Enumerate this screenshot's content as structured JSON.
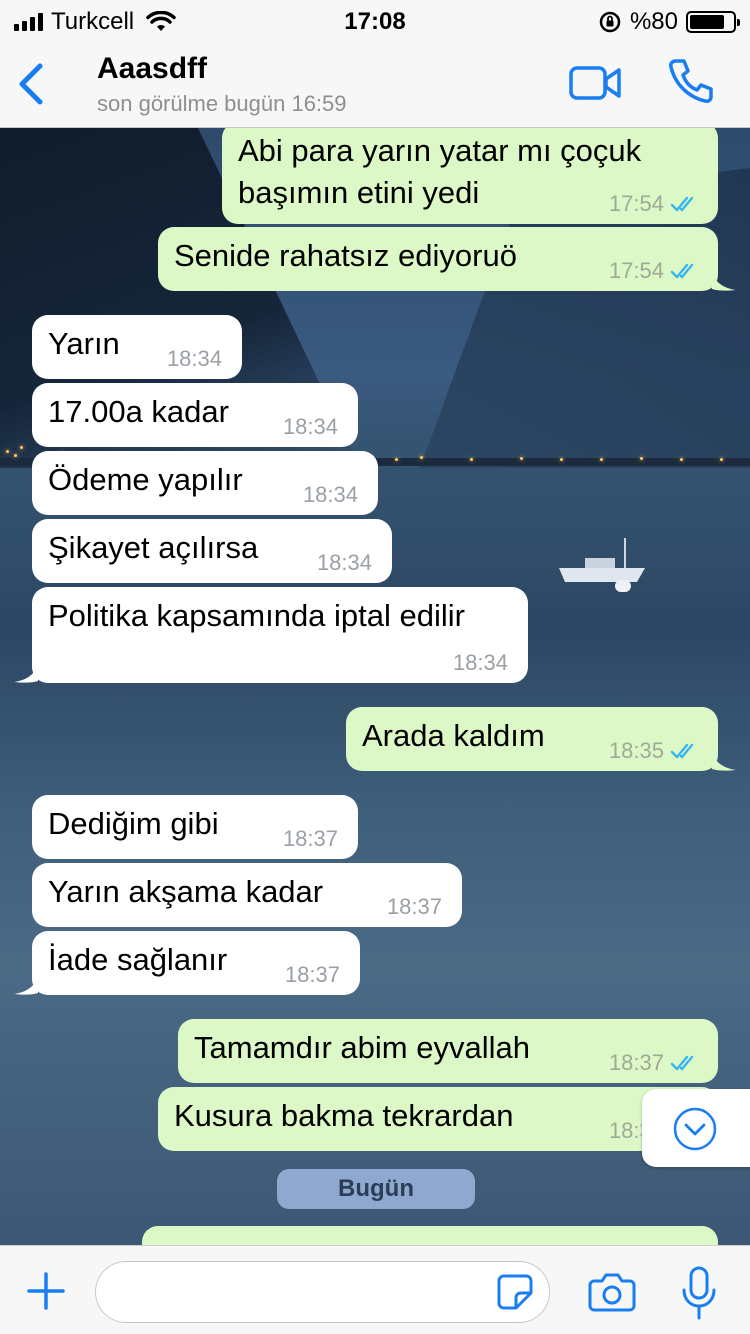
{
  "status_bar": {
    "carrier": "Turkcell",
    "time": "17:08",
    "battery_text": "%80",
    "battery_level": 0.8
  },
  "header": {
    "back_icon": "chevron-left-icon",
    "contact_name": "Aaasdff",
    "last_seen": "son görülme bugün 16:59",
    "video_icon": "video-icon",
    "call_icon": "phone-icon",
    "accent_color": "#1a7ef2"
  },
  "messages": [
    {
      "dir": "out",
      "lines": [
        "Abi para yarın yatar mı çoçuk",
        "başımın etini yedi"
      ],
      "time": "17:54",
      "read": true
    },
    {
      "dir": "out",
      "lines": [
        "Senide rahatsız ediyoruö"
      ],
      "time": "17:54",
      "read": true
    },
    {
      "dir": "in",
      "lines": [
        "Yarın"
      ],
      "time": "18:34"
    },
    {
      "dir": "in",
      "lines": [
        "17.00a kadar"
      ],
      "time": "18:34"
    },
    {
      "dir": "in",
      "lines": [
        "Ödeme yapılır"
      ],
      "time": "18:34"
    },
    {
      "dir": "in",
      "lines": [
        "Şikayet açılırsa"
      ],
      "time": "18:34"
    },
    {
      "dir": "in",
      "lines": [
        "Politika kapsamında iptal edilir"
      ],
      "time": "18:34"
    },
    {
      "dir": "out",
      "lines": [
        "Arada kaldım"
      ],
      "time": "18:35",
      "read": true
    },
    {
      "dir": "in",
      "lines": [
        "Dediğim gibi"
      ],
      "time": "18:37"
    },
    {
      "dir": "in",
      "lines": [
        "Yarın akşama kadar"
      ],
      "time": "18:37"
    },
    {
      "dir": "in",
      "lines": [
        "İade sağlanır"
      ],
      "time": "18:37"
    },
    {
      "dir": "out",
      "lines": [
        "Tamamdır abim eyvallah"
      ],
      "time": "18:37",
      "read": true
    },
    {
      "dir": "out",
      "lines": [
        "Kusura bakma tekrardan"
      ],
      "time": "18:37",
      "read": true
    }
  ],
  "date_separator": "Bugün",
  "scroll_button_icon": "chevron-down-circle-icon",
  "input_bar": {
    "plus_icon": "plus-icon",
    "message_value": "",
    "sticker_icon": "sticker-icon",
    "camera_icon": "camera-icon",
    "mic_icon": "microphone-icon"
  },
  "colors": {
    "incoming_bubble": "#ffffff",
    "outgoing_bubble": "#dcf8c6",
    "read_ticks": "#34b7f1",
    "date_pill": "#8ea8d0"
  }
}
